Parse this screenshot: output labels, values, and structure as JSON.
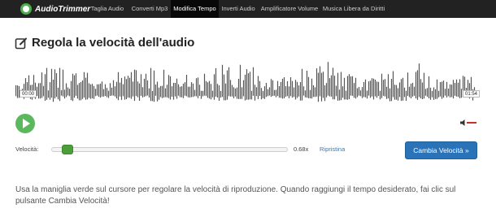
{
  "brand": {
    "name": "AudioTrimmer"
  },
  "nav": {
    "items": [
      {
        "label": "Taglia Audio"
      },
      {
        "label": "Converti Mp3"
      },
      {
        "label": "Modifica Tempo"
      },
      {
        "label": "Inverti Audio"
      },
      {
        "label": "Amplificatore Volume"
      },
      {
        "label": "Musica Libera da Diritti"
      }
    ],
    "active": "Modifica Tempo"
  },
  "page": {
    "title": "Regola la velocità dell'audio"
  },
  "player": {
    "time_start": "00:00",
    "time_end": "01:54"
  },
  "speed": {
    "label": "Velocità:",
    "value": "0.68x",
    "value_fraction": 0.07,
    "reset_label": "Ripristina",
    "apply_label": "Cambia Velocità »"
  },
  "instructions": "Usa la maniglia verde sul cursore per regolare la velocità di riproduzione. Quando raggiungi il tempo desiderato, fai clic sul pulsante Cambia Velocità!",
  "colors": {
    "navbar": "#222222",
    "play_button": "#5cb85c",
    "slider_handle": "#4b9e3a",
    "apply_button": "#2a73b8",
    "waveform": "#555555",
    "reset_link": "#337ab7"
  },
  "icons": [
    "logo-icon",
    "edit-icon",
    "play-icon",
    "speaker-icon"
  ]
}
